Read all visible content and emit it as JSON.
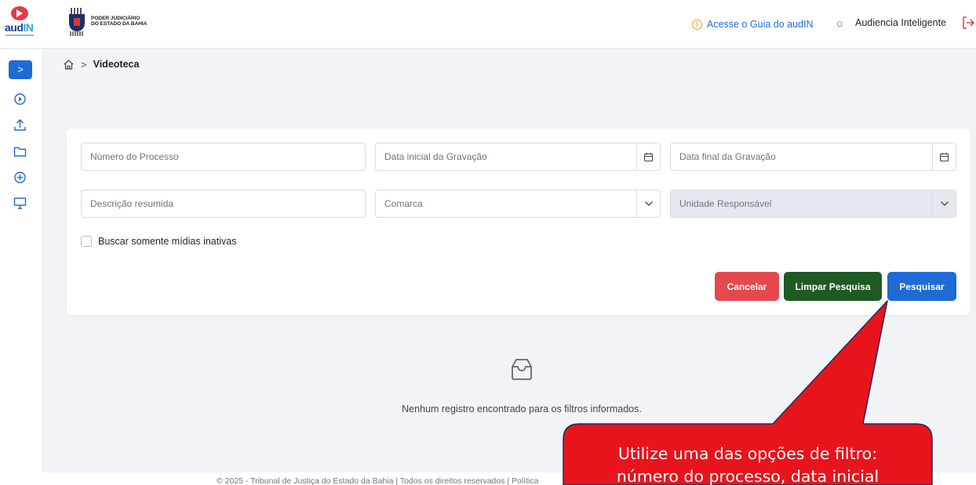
{
  "header": {
    "app_logo_text_a": "aud",
    "app_logo_text_b": "IN",
    "org_line1": "PODER JUDICIÁRIO",
    "org_line2": "DO ESTADO DA BAHIA",
    "guide_link": "Acesse o Guia do audIN",
    "user_name": "Audiencia Inteligente"
  },
  "sidebar": {
    "toggle_label": ">",
    "items": [
      {
        "icon": "play-circle-icon"
      },
      {
        "icon": "upload-icon"
      },
      {
        "icon": "folder-icon"
      },
      {
        "icon": "plus-circle-icon"
      },
      {
        "icon": "monitor-icon"
      }
    ]
  },
  "breadcrumb": {
    "separator": ">",
    "current": "Videoteca"
  },
  "filters": {
    "process_number_placeholder": "Número do Processo",
    "start_date_placeholder": "Data inicial da Gravação",
    "end_date_placeholder": "Data final da Gravação",
    "description_placeholder": "Descrição resumida",
    "comarca_placeholder": "Comarca",
    "unit_placeholder": "Unidade Responsável",
    "inactive_checkbox_label": "Buscar somente mídias inativas"
  },
  "actions": {
    "cancel_label": "Cancelar",
    "clear_label": "Limpar Pesquisa",
    "search_label": "Pesquisar"
  },
  "empty_state": {
    "message": "Nenhum registro encontrado para os filtros informados."
  },
  "footer": {
    "text": "© 2025 - Tribunal de Justiça do Estado da Bahia | Todos os direitos reservados | Política"
  },
  "callout": {
    "line1": "Utilize uma das opções de filtro:",
    "line2": "número do processo, data inicial"
  },
  "colors": {
    "primary": "#1e6bd6",
    "cancel": "#e5484d",
    "clear": "#1f5a24",
    "callout": "#e8141c"
  }
}
